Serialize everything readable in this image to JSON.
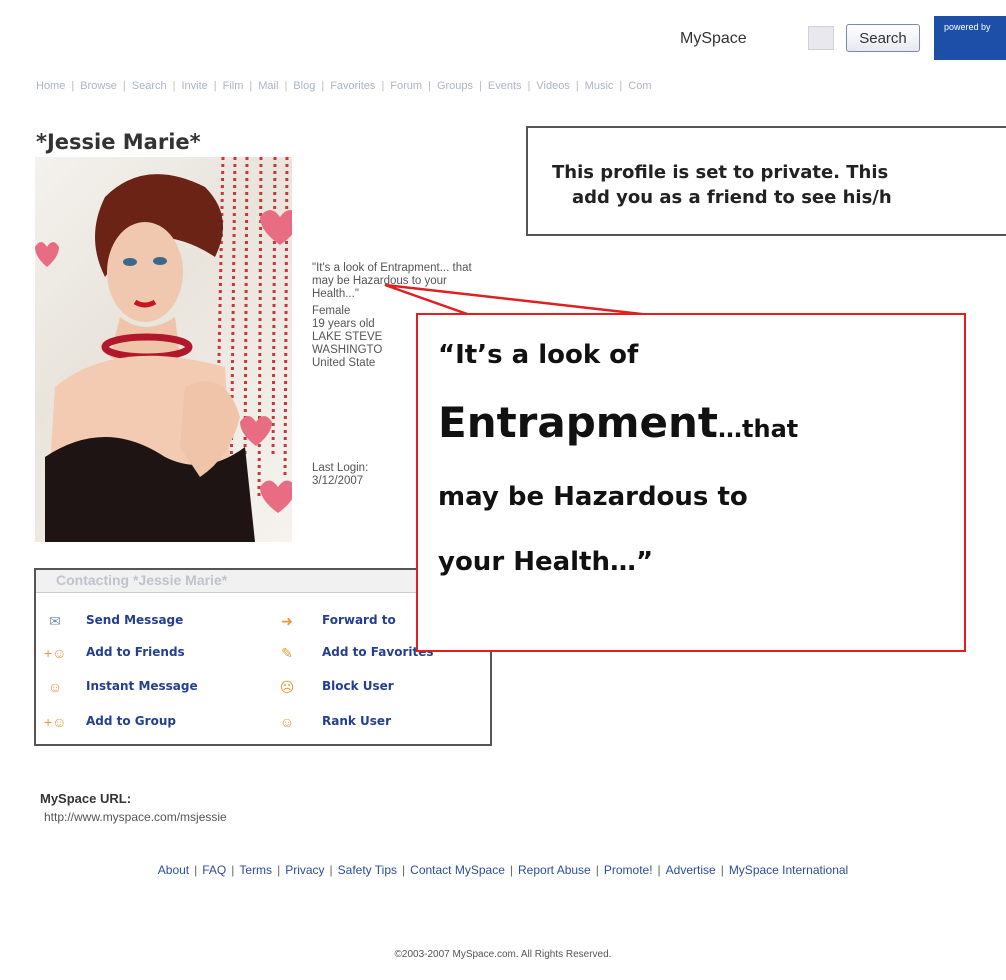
{
  "header": {
    "site_label": "MySpace",
    "search_button": "Search",
    "powered_by": "powered by"
  },
  "nav": [
    "Home",
    "Browse",
    "Search",
    "Invite",
    "Film",
    "Mail",
    "Blog",
    "Favorites",
    "Forum",
    "Groups",
    "Events",
    "Videos",
    "Music",
    "Com"
  ],
  "profile": {
    "name": "*Jessie Marie*",
    "quote": "\"It's a look of Entrapment... that may be Hazardous to your Health...\"",
    "gender": "Female",
    "age": "19 years old",
    "city": "LAKE STEVE",
    "state": "WASHINGTO",
    "country": "United State",
    "last_login_label": "Last Login:",
    "last_login_date": "3/12/2007"
  },
  "private_notice": {
    "line1": "This profile is set to private. This",
    "line2": "add you as a friend to see his/h"
  },
  "contact": {
    "title": "Contacting *Jessie Marie*",
    "items": [
      {
        "label": "Send Message",
        "icon": "envelope-icon"
      },
      {
        "label": "Forward to",
        "icon": "forward-icon"
      },
      {
        "label": "Add to Friends",
        "icon": "add-friend-icon"
      },
      {
        "label": "Add to Favorites",
        "icon": "favorite-icon"
      },
      {
        "label": "Instant Message",
        "icon": "instant-message-icon"
      },
      {
        "label": "Block User",
        "icon": "block-user-icon"
      },
      {
        "label": "Add to Group",
        "icon": "add-group-icon"
      },
      {
        "label": "Rank User",
        "icon": "rank-user-icon"
      }
    ]
  },
  "url": {
    "label": "MySpace URL:",
    "value": "http://www.myspace.com/msjessie"
  },
  "footer": {
    "links": [
      "About",
      "FAQ",
      "Terms",
      "Privacy",
      "Safety Tips",
      "Contact MySpace",
      "Report Abuse",
      "Promote!",
      "Advertise",
      "MySpace International"
    ],
    "copyright": "©2003-2007 MySpace.com. All Rights Reserved."
  },
  "callout": {
    "line1": "“It’s a look of",
    "line2_big": "Entrapment",
    "line2_small": "…that",
    "line3": "may be Hazardous to",
    "line4": "your Health…”"
  },
  "colors": {
    "link_blue": "#233f8f",
    "callout_border": "#e02020",
    "powered_bg": "#1d4fa8"
  }
}
